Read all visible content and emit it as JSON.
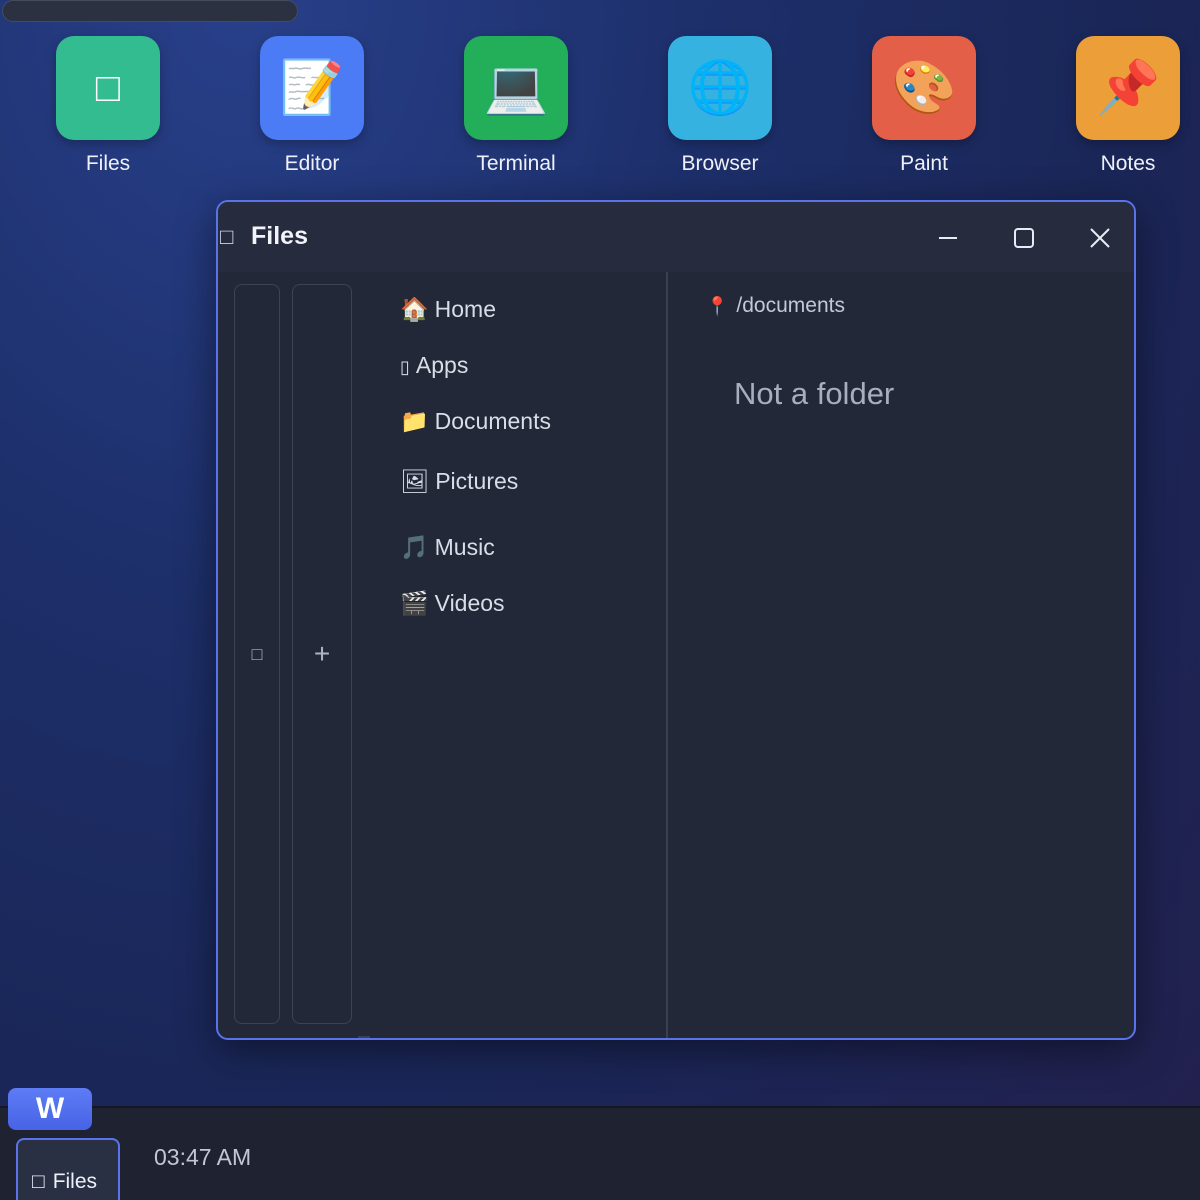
{
  "desktop": {
    "icons": [
      {
        "label": "Files",
        "glyph": "□",
        "color": "#33bc8f"
      },
      {
        "label": "Editor",
        "glyph": "📝",
        "color": "#4b7bf5"
      },
      {
        "label": "Terminal",
        "glyph": "💻",
        "color": "#23ae5a"
      },
      {
        "label": "Browser",
        "glyph": "🌐",
        "color": "#36b2e0"
      },
      {
        "label": "Paint",
        "glyph": "🎨",
        "color": "#e35f47"
      },
      {
        "label": "Notes",
        "glyph": "📌",
        "color": "#ec9e38"
      }
    ]
  },
  "window": {
    "title": "Files",
    "title_icon": "□",
    "controls": {
      "minimize": "–",
      "maximize": "▢",
      "close": "✕"
    },
    "rail": {
      "left_glyph": "□",
      "add_glyph": "+"
    },
    "nav": [
      {
        "icon": "🏠",
        "label": "Home"
      },
      {
        "icon": "▯",
        "label": "Apps"
      },
      {
        "icon": "📁",
        "label": "Documents"
      },
      {
        "icon": "🖼",
        "label": "Pictures"
      },
      {
        "icon": "🎵",
        "label": "Music"
      },
      {
        "icon": "🎬",
        "label": "Videos"
      }
    ],
    "path_icon": "📍",
    "path": "/documents",
    "message": "Not a folder"
  },
  "taskbar": {
    "start_label": "W",
    "task_icon": "□",
    "task_label": "Files",
    "clock": "03:47 AM"
  },
  "colors": {
    "accent": "#5a73e8",
    "window_bg": "#232838",
    "taskbar_bg": "#1f2331"
  }
}
